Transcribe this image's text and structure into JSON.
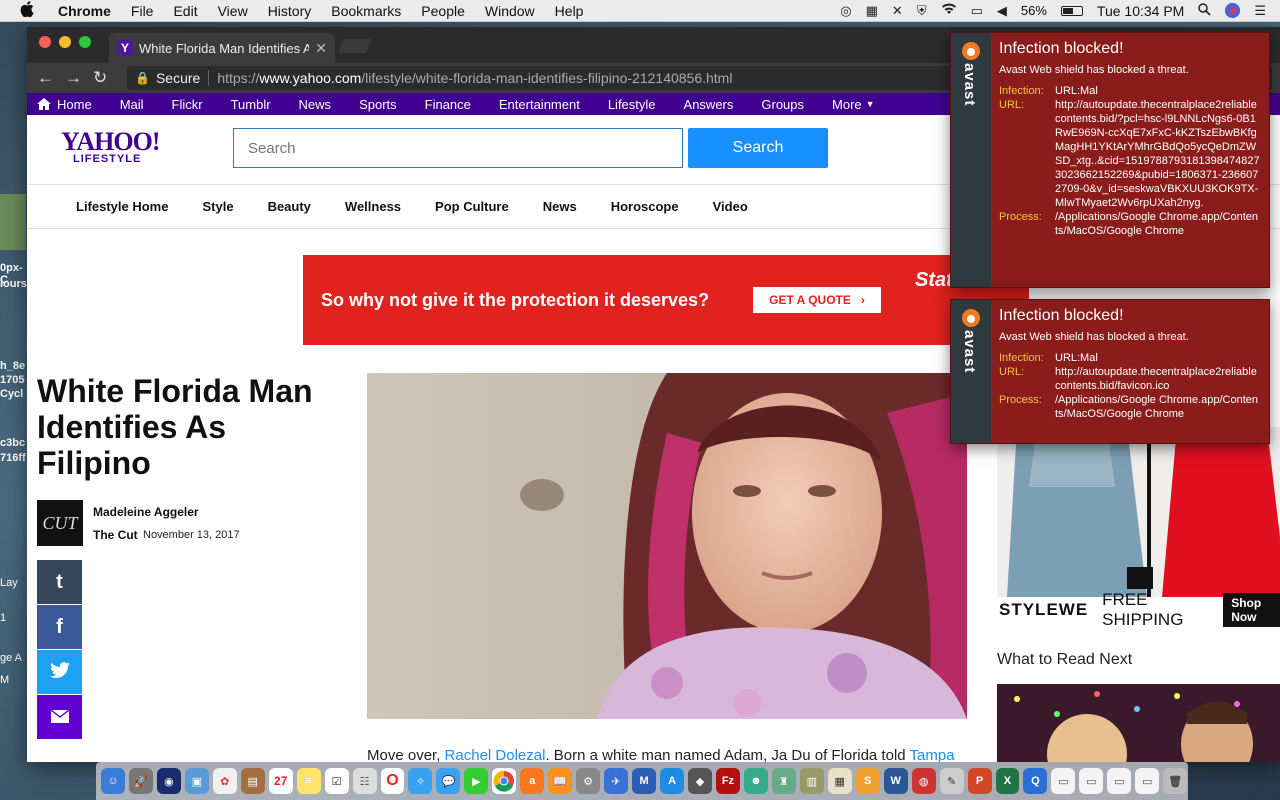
{
  "menubar": {
    "app_name": "Chrome",
    "items": [
      "File",
      "Edit",
      "View",
      "History",
      "Bookmarks",
      "People",
      "Window",
      "Help"
    ],
    "battery_percent": "56%",
    "battery_level": 0.56,
    "clock": "Tue 10:34 PM"
  },
  "browser": {
    "tab_title": "White Florida Man Identifies As Filipino",
    "secure_label": "Secure",
    "url_scheme": "https://",
    "url_host": "www.yahoo.com",
    "url_path": "/lifestyle/white-florida-man-identifies-filipino-212140856.html"
  },
  "yahoo_nav": {
    "items": [
      "Home",
      "Mail",
      "Flickr",
      "Tumblr",
      "News",
      "Sports",
      "Finance",
      "Entertainment",
      "Lifestyle",
      "Answers",
      "Groups",
      "More"
    ]
  },
  "header": {
    "logo_text": "YAHOO!",
    "logo_sub": "LIFESTYLE",
    "search_placeholder": "Search",
    "search_button": "Search"
  },
  "subnav": {
    "items": [
      "Lifestyle Home",
      "Style",
      "Beauty",
      "Wellness",
      "Pop Culture",
      "News",
      "Horoscope",
      "Video"
    ]
  },
  "ad": {
    "text": "So why not give it the protection it deserves?",
    "cta": "GET A QUOTE",
    "brand_partial": "Stat"
  },
  "article": {
    "headline": "White Florida Man Identifies As Filipino",
    "author": "Madeleine Aggeler",
    "source": "The Cut",
    "source_logo": "CUT",
    "date": "November 13, 2017",
    "body_start": "Move over, ",
    "body_link1": "Rachel Dolezal",
    "body_mid": ". Born a white man named Adam, Ja Du of Florida told ",
    "body_link2": "Tampa"
  },
  "share": {
    "tumblr": "t",
    "facebook": "f",
    "twitter": "🐦",
    "email": "✉"
  },
  "right_column": {
    "ad_brand": "STYLEWE",
    "ad_shipping": "FREE SHIPPING",
    "ad_shop": "Shop Now",
    "what_to_read": "What to Read Next"
  },
  "avast_alerts": [
    {
      "brand": "avast",
      "title": "Infection blocked!",
      "desc": "Avast Web shield has blocked a threat.",
      "infection_label": "Infection:",
      "infection": "URL:Mal",
      "url_label": "URL:",
      "url": "http://autoupdate.thecentralplace2reliablecontents.bid/?pcl=hsc-l9LNNLcNgs6-0B1RwE969N-ccXqE7xFxC-kKZTszEbwBKfgMagHH1YKtArYMhrGBdQo5ycQeDmZWSD_xtg..&cid=151978879318139847482730236621522​69&pubid=1806371-2366072709-0&v_id=seskwaVBKXUU3KOK9TX-MlwTMyaet2Wv6rpUXah2nyg.",
      "process_label": "Process:",
      "process": "/Applications/Google Chrome.app/Contents/MacOS/Google Chrome"
    },
    {
      "brand": "avast",
      "title": "Infection blocked!",
      "desc": "Avast Web shield has blocked a threat.",
      "infection_label": "Infection:",
      "infection": "URL:Mal",
      "url_label": "URL:",
      "url": "http://autoupdate.thecentralplace2reliablecontents.bid/favicon.ico",
      "process_label": "Process:",
      "process": "/Applications/Google Chrome.app/Contents/MacOS/Google Chrome"
    }
  ],
  "dock": {
    "calendar_day": "27"
  },
  "desktop": {
    "fragments": [
      "0px-C",
      "lours",
      "h_8e",
      "1705",
      "Cycl",
      "c3bc",
      "716ff",
      "Lay",
      "1",
      "ge A",
      "M"
    ]
  },
  "colors": {
    "yahoo_purple": "#400090",
    "search_blue": "#188fff",
    "ad_red": "#e2221f",
    "avast_red": "#8b1c1c",
    "avast_label": "#f5c542",
    "tumblr": "#36465d",
    "facebook": "#3b5998",
    "twitter": "#1da1f2",
    "email": "#6001d2"
  }
}
